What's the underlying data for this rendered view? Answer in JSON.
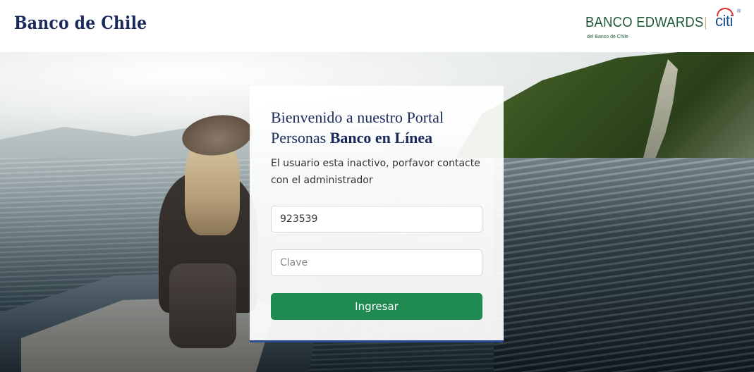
{
  "header": {
    "logo_left": "Banco de Chile",
    "logo_right_main": "BANCO EDWARDS",
    "logo_right_citi": "citi",
    "logo_right_sub": "del Banco de Chile",
    "logo_right_reg": "®"
  },
  "login": {
    "title_line1": "Bienvenido a nuestro Portal",
    "title_line2_prefix": "Personas ",
    "title_line2_bold": "Banco en Línea",
    "message": "El usuario esta inactivo, porfavor contacte con el administrador",
    "username_value": "923539",
    "password_placeholder": "Clave",
    "submit_label": "Ingresar"
  },
  "colors": {
    "brand_navy": "#1b2a5c",
    "button_green": "#1f8a52",
    "edwards_green": "#1d5a35",
    "citi_blue": "#1a4f8f",
    "citi_red": "#e32b2b",
    "card_border": "#2a4d8f"
  }
}
